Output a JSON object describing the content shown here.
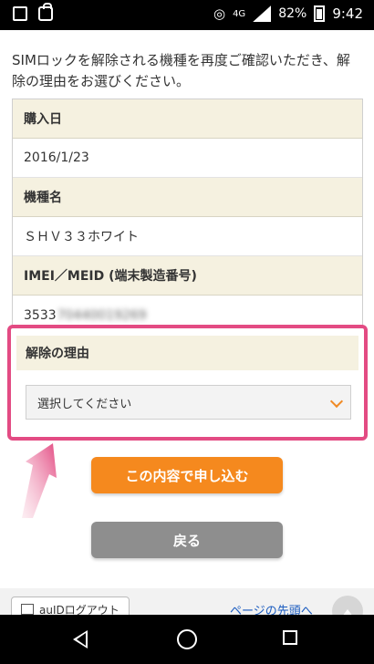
{
  "status": {
    "network": "4G",
    "battery": "82%",
    "time": "9:42"
  },
  "intro": "SIMロックを解除される機種を再度ご確認いただき、解除の理由をお選びください。",
  "fields": {
    "purchase_label": "購入日",
    "purchase_value": "2016/1/23",
    "model_label": "機種名",
    "model_value": "ＳＨＶ３３ホワイト",
    "imei_label": "IMEI／MEID (端末製造番号)",
    "imei_visible": "3533",
    "imei_masked": "70440019269"
  },
  "reason": {
    "label": "解除の理由",
    "select_value": "選択してください"
  },
  "buttons": {
    "apply": "この内容で申し込む",
    "back": "戻る"
  },
  "footer": {
    "logout": "auIDログアウト",
    "page_top": "ページの先頭へ"
  },
  "colors": {
    "accent": "#f5891e",
    "highlight": "#e34b83",
    "header_bg": "#f5f1e0",
    "back_button": "#8e8e8e"
  }
}
